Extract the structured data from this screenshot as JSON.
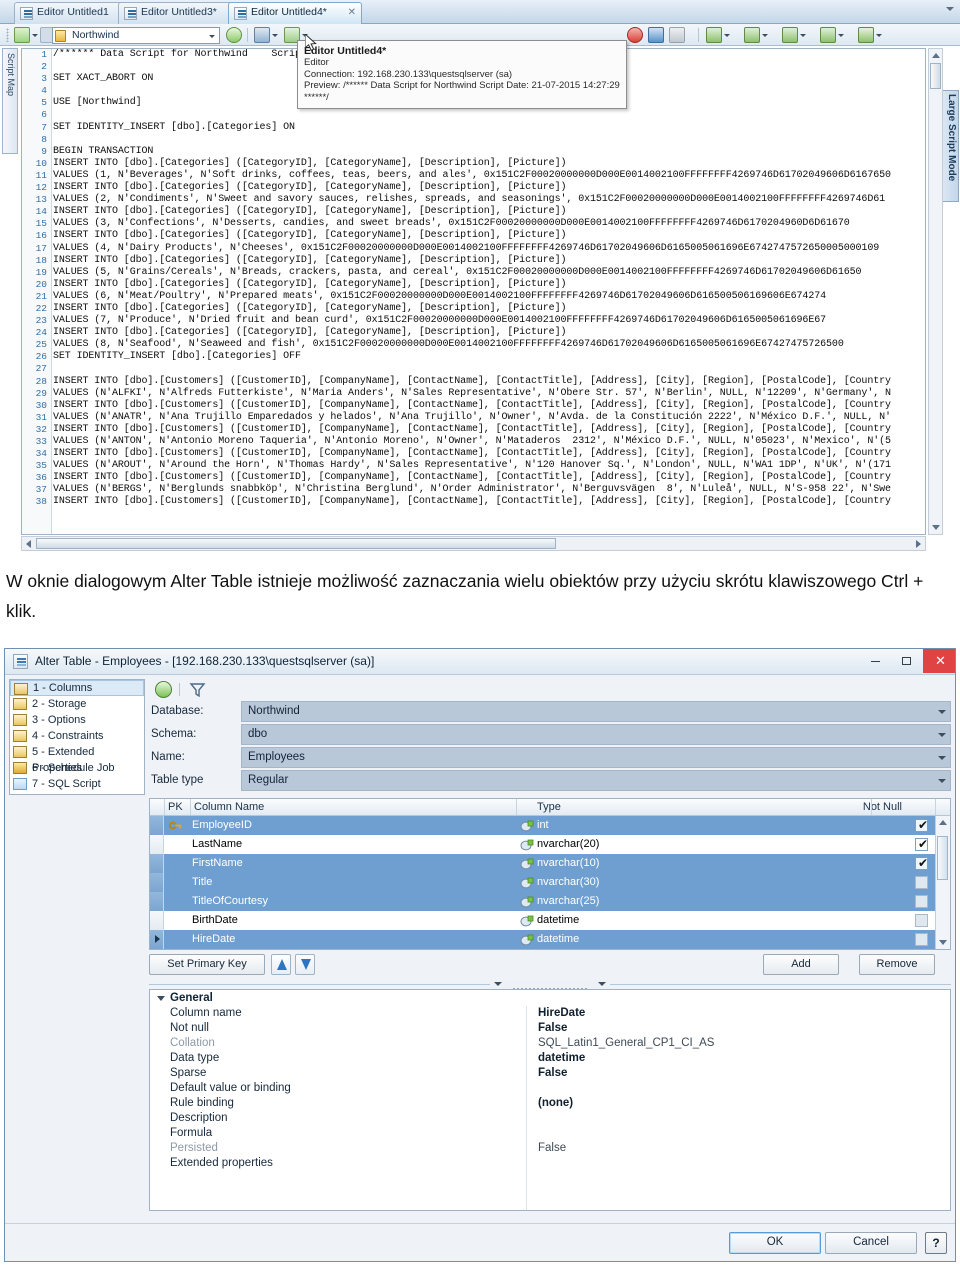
{
  "editor": {
    "tabs": [
      {
        "label": "Editor Untitled1",
        "active": false,
        "closable": false
      },
      {
        "label": "Editor Untitled3*",
        "active": false,
        "closable": false
      },
      {
        "label": "Editor Untitled4*",
        "active": true,
        "closable": true
      }
    ],
    "toolbar": {
      "execute_icon": "execute-script-icon",
      "variables_icon": "variables-icon",
      "database_value": "Northwind",
      "refresh_icon": "refresh-icon",
      "format_icon": "format-sql-icon",
      "compare_icon": "compare-icon",
      "stop_icon": "stop-icon",
      "debug_icon": "debug-icon",
      "settings_icon": "settings-icon",
      "results_grid_icon": "results-to-grid-icon",
      "results_text_icon": "results-to-text-icon",
      "results_file_icon": "results-to-file-icon",
      "export_icon": "export-results-icon",
      "session_icon": "session-icon"
    },
    "side_tab_left": "Script Map",
    "side_tab_right": "Large Script Mode",
    "tooltip": {
      "title": "Editor Untitled4*",
      "type": "Editor",
      "connection": "Connection: 192.168.230.133\\questsqlserver (sa)",
      "preview": "Preview: /****** Data Script for Northwind   Script Date: 21-07-2015 14:27:29 ******/"
    },
    "code_lines": [
      {
        "n": 1,
        "text": "/****** Data Script for Northwind    Script Date: 21-07-2015 14:27:29 ******/"
      },
      {
        "n": 2,
        "text": ""
      },
      {
        "n": 3,
        "text": "SET XACT_ABORT ON"
      },
      {
        "n": 4,
        "text": ""
      },
      {
        "n": 5,
        "text": "USE [Northwind]"
      },
      {
        "n": 6,
        "text": ""
      },
      {
        "n": 7,
        "text": "SET IDENTITY_INSERT [dbo].[Categories] ON"
      },
      {
        "n": 8,
        "text": ""
      },
      {
        "n": 9,
        "text": "BEGIN TRANSACTION"
      },
      {
        "n": 10,
        "text": "INSERT INTO [dbo].[Categories] ([CategoryID], [CategoryName], [Description], [Picture])"
      },
      {
        "n": 11,
        "text": "VALUES (1, N'Beverages', N'Soft drinks, coffees, teas, beers, and ales', 0x151C2F00020000000D000E0014002100FFFFFFFF4269746D61702049606D6167650"
      },
      {
        "n": 12,
        "text": "INSERT INTO [dbo].[Categories] ([CategoryID], [CategoryName], [Description], [Picture])"
      },
      {
        "n": 13,
        "text": "VALUES (2, N'Condiments', N'Sweet and savory sauces, relishes, spreads, and seasonings', 0x151C2F00020000000D000E0014002100FFFFFFFF4269746D61"
      },
      {
        "n": 14,
        "text": "INSERT INTO [dbo].[Categories] ([CategoryID], [CategoryName], [Description], [Picture])"
      },
      {
        "n": 15,
        "text": "VALUES (3, N'Confections', N'Desserts, candies, and sweet breads', 0x151C2F00020000000D000E0014002100FFFFFFFF4269746D6170204960D6D61670"
      },
      {
        "n": 16,
        "text": "INSERT INTO [dbo].[Categories] ([CategoryID], [CategoryName], [Description], [Picture])"
      },
      {
        "n": 17,
        "text": "VALUES (4, N'Dairy Products', N'Cheeses', 0x151C2F00020000000D000E0014002100FFFFFFFF4269746D61702049606D6165005061696E6742747572650005000109"
      },
      {
        "n": 18,
        "text": "INSERT INTO [dbo].[Categories] ([CategoryID], [CategoryName], [Description], [Picture])"
      },
      {
        "n": 19,
        "text": "VALUES (5, N'Grains/Cereals', N'Breads, crackers, pasta, and cereal', 0x151C2F00020000000D000E0014002100FFFFFFFF4269746D61702049606D61650"
      },
      {
        "n": 20,
        "text": "INSERT INTO [dbo].[Categories] ([CategoryID], [CategoryName], [Description], [Picture])"
      },
      {
        "n": 21,
        "text": "VALUES (6, N'Meat/Poultry', N'Prepared meats', 0x151C2F00020000000D000E0014002100FFFFFFFF4269746D61702049606D616500506169606E674274"
      },
      {
        "n": 22,
        "text": "INSERT INTO [dbo].[Categories] ([CategoryID], [CategoryName], [Description], [Picture])"
      },
      {
        "n": 23,
        "text": "VALUES (7, N'Produce', N'Dried fruit and bean curd', 0x151C2F00020000000D000E0014002100FFFFFFFF4269746D61702049606D6165005061696E67"
      },
      {
        "n": 24,
        "text": "INSERT INTO [dbo].[Categories] ([CategoryID], [CategoryName], [Description], [Picture])"
      },
      {
        "n": 25,
        "text": "VALUES (8, N'Seafood', N'Seaweed and fish', 0x151C2F00020000000D000E0014002100FFFFFFFF4269746D61702049606D6165005061696E67427475726500"
      },
      {
        "n": 26,
        "text": "SET IDENTITY_INSERT [dbo].[Categories] OFF"
      },
      {
        "n": 27,
        "text": ""
      },
      {
        "n": 28,
        "text": "INSERT INTO [dbo].[Customers] ([CustomerID], [CompanyName], [ContactName], [ContactTitle], [Address], [City], [Region], [PostalCode], [Country"
      },
      {
        "n": 29,
        "text": "VALUES (N'ALFKI', N'Alfreds Futterkiste', N'Maria Anders', N'Sales Representative', N'Obere Str. 57', N'Berlin', NULL, N'12209', N'Germany', N"
      },
      {
        "n": 30,
        "text": "INSERT INTO [dbo].[Customers] ([CustomerID], [CompanyName], [ContactName], [ContactTitle], [Address], [City], [Region], [PostalCode], [Country"
      },
      {
        "n": 31,
        "text": "VALUES (N'ANATR', N'Ana Trujillo Emparedados y helados', N'Ana Trujillo', N'Owner', N'Avda. de la Constitución 2222', N'México D.F.', NULL, N'"
      },
      {
        "n": 32,
        "text": "INSERT INTO [dbo].[Customers] ([CustomerID], [CompanyName], [ContactName], [ContactTitle], [Address], [City], [Region], [PostalCode], [Country"
      },
      {
        "n": 33,
        "text": "VALUES (N'ANTON', N'Antonio Moreno Taqueria', N'Antonio Moreno', N'Owner', N'Mataderos  2312', N'México D.F.', NULL, N'05023', N'Mexico', N'(5"
      },
      {
        "n": 34,
        "text": "INSERT INTO [dbo].[Customers] ([CustomerID], [CompanyName], [ContactName], [ContactTitle], [Address], [City], [Region], [PostalCode], [Country"
      },
      {
        "n": 35,
        "text": "VALUES (N'AROUT', N'Around the Horn', N'Thomas Hardy', N'Sales Representative', N'120 Hanover Sq.', N'London', NULL, N'WA1 1DP', N'UK', N'(171"
      },
      {
        "n": 36,
        "text": "INSERT INTO [dbo].[Customers] ([CustomerID], [CompanyName], [ContactName], [ContactTitle], [Address], [City], [Region], [PostalCode], [Country"
      },
      {
        "n": 37,
        "text": "VALUES (N'BERGS', N'Berglunds snabbköp', N'Christina Berglund', N'Order Administrator', N'Berguvsvägen  8', N'Luleå', NULL, N'S-958 22', N'Swe"
      },
      {
        "n": 38,
        "text": "INSERT INTO [dbo].[Customers] ([CustomerID], [CompanyName], [ContactName], [ContactTitle], [Address], [City], [Region], [PostalCode], [Country"
      }
    ]
  },
  "caption": "W oknie dialogowym Alter Table istnieje możliwość zaznaczania wielu obiektów przy użyciu skrótu klawiszowego Ctrl + klik.",
  "dialog": {
    "title": "Alter Table - Employees - [192.168.230.133\\questsqlserver (sa)]",
    "window_buttons": {
      "minimize": "minimize-icon",
      "maximize": "maximize-icon",
      "close": "close-icon"
    },
    "nav_items": [
      {
        "label": "1 - Columns",
        "selected": true,
        "icon": "table-icon"
      },
      {
        "label": "2 - Storage",
        "selected": false,
        "icon": "table-icon"
      },
      {
        "label": "3 - Options",
        "selected": false,
        "icon": "table-icon"
      },
      {
        "label": "4 - Constraints",
        "selected": false,
        "icon": "table-icon"
      },
      {
        "label": "5 - Extended Properties",
        "selected": false,
        "icon": "table-icon"
      },
      {
        "label": "6 - Schedule Job",
        "selected": false,
        "icon": "schedule-lock-icon"
      },
      {
        "label": "7 - SQL Script",
        "selected": false,
        "icon": "sql-script-icon"
      }
    ],
    "mini_toolbar": {
      "refresh_icon": "refresh-icon",
      "filter_icon": "filter-icon"
    },
    "fields": [
      {
        "label": "Database:",
        "value": "Northwind"
      },
      {
        "label": "Schema:",
        "value": "dbo"
      },
      {
        "label": "Name:",
        "value": "Employees"
      },
      {
        "label": "Table type",
        "value": "Regular"
      }
    ],
    "grid": {
      "headers": [
        "PK",
        "Column Name",
        "Type",
        "Not Null"
      ],
      "rows": [
        {
          "pk": true,
          "name": "EmployeeID",
          "type": "int",
          "not_null": true,
          "selected": true,
          "current": false
        },
        {
          "pk": false,
          "name": "LastName",
          "type": "nvarchar(20)",
          "not_null": true,
          "selected": false,
          "current": false
        },
        {
          "pk": false,
          "name": "FirstName",
          "type": "nvarchar(10)",
          "not_null": true,
          "selected": true,
          "current": false
        },
        {
          "pk": false,
          "name": "Title",
          "type": "nvarchar(30)",
          "not_null": false,
          "selected": true,
          "current": false
        },
        {
          "pk": false,
          "name": "TitleOfCourtesy",
          "type": "nvarchar(25)",
          "not_null": false,
          "selected": true,
          "current": false
        },
        {
          "pk": false,
          "name": "BirthDate",
          "type": "datetime",
          "not_null": false,
          "selected": false,
          "current": false
        },
        {
          "pk": false,
          "name": "HireDate",
          "type": "datetime",
          "not_null": false,
          "selected": true,
          "current": true
        }
      ]
    },
    "grid_buttons": {
      "set_primary_key": "Set Primary Key",
      "move_up_icon": "arrow-up-icon",
      "move_down_icon": "arrow-down-icon",
      "add": "Add",
      "remove": "Remove"
    },
    "properties": {
      "group": "General",
      "rows": [
        {
          "key": "Column name",
          "value": "HireDate",
          "dim": false
        },
        {
          "key": "Not null",
          "value": "False",
          "dim": false
        },
        {
          "key": "Collation",
          "value": "SQL_Latin1_General_CP1_CI_AS",
          "dim": true
        },
        {
          "key": "Data type",
          "value": "datetime",
          "dim": false
        },
        {
          "key": "Sparse",
          "value": "False",
          "dim": false
        },
        {
          "key": "Default value or binding",
          "value": "",
          "dim": false
        },
        {
          "key": "Rule binding",
          "value": "(none)",
          "dim": false
        },
        {
          "key": "Description",
          "value": "",
          "dim": false
        },
        {
          "key": "Formula",
          "value": "",
          "dim": false
        },
        {
          "key": "Persisted",
          "value": "False",
          "dim": true
        },
        {
          "key": "Extended properties",
          "value": "",
          "dim": false
        }
      ]
    },
    "footer": {
      "ok": "OK",
      "cancel": "Cancel",
      "help": "?"
    }
  },
  "colors": {
    "accent": "#2f6ea5",
    "selection": "#6f9fd0",
    "close_red": "#e04343",
    "field_fill": "#b9c8d8"
  }
}
